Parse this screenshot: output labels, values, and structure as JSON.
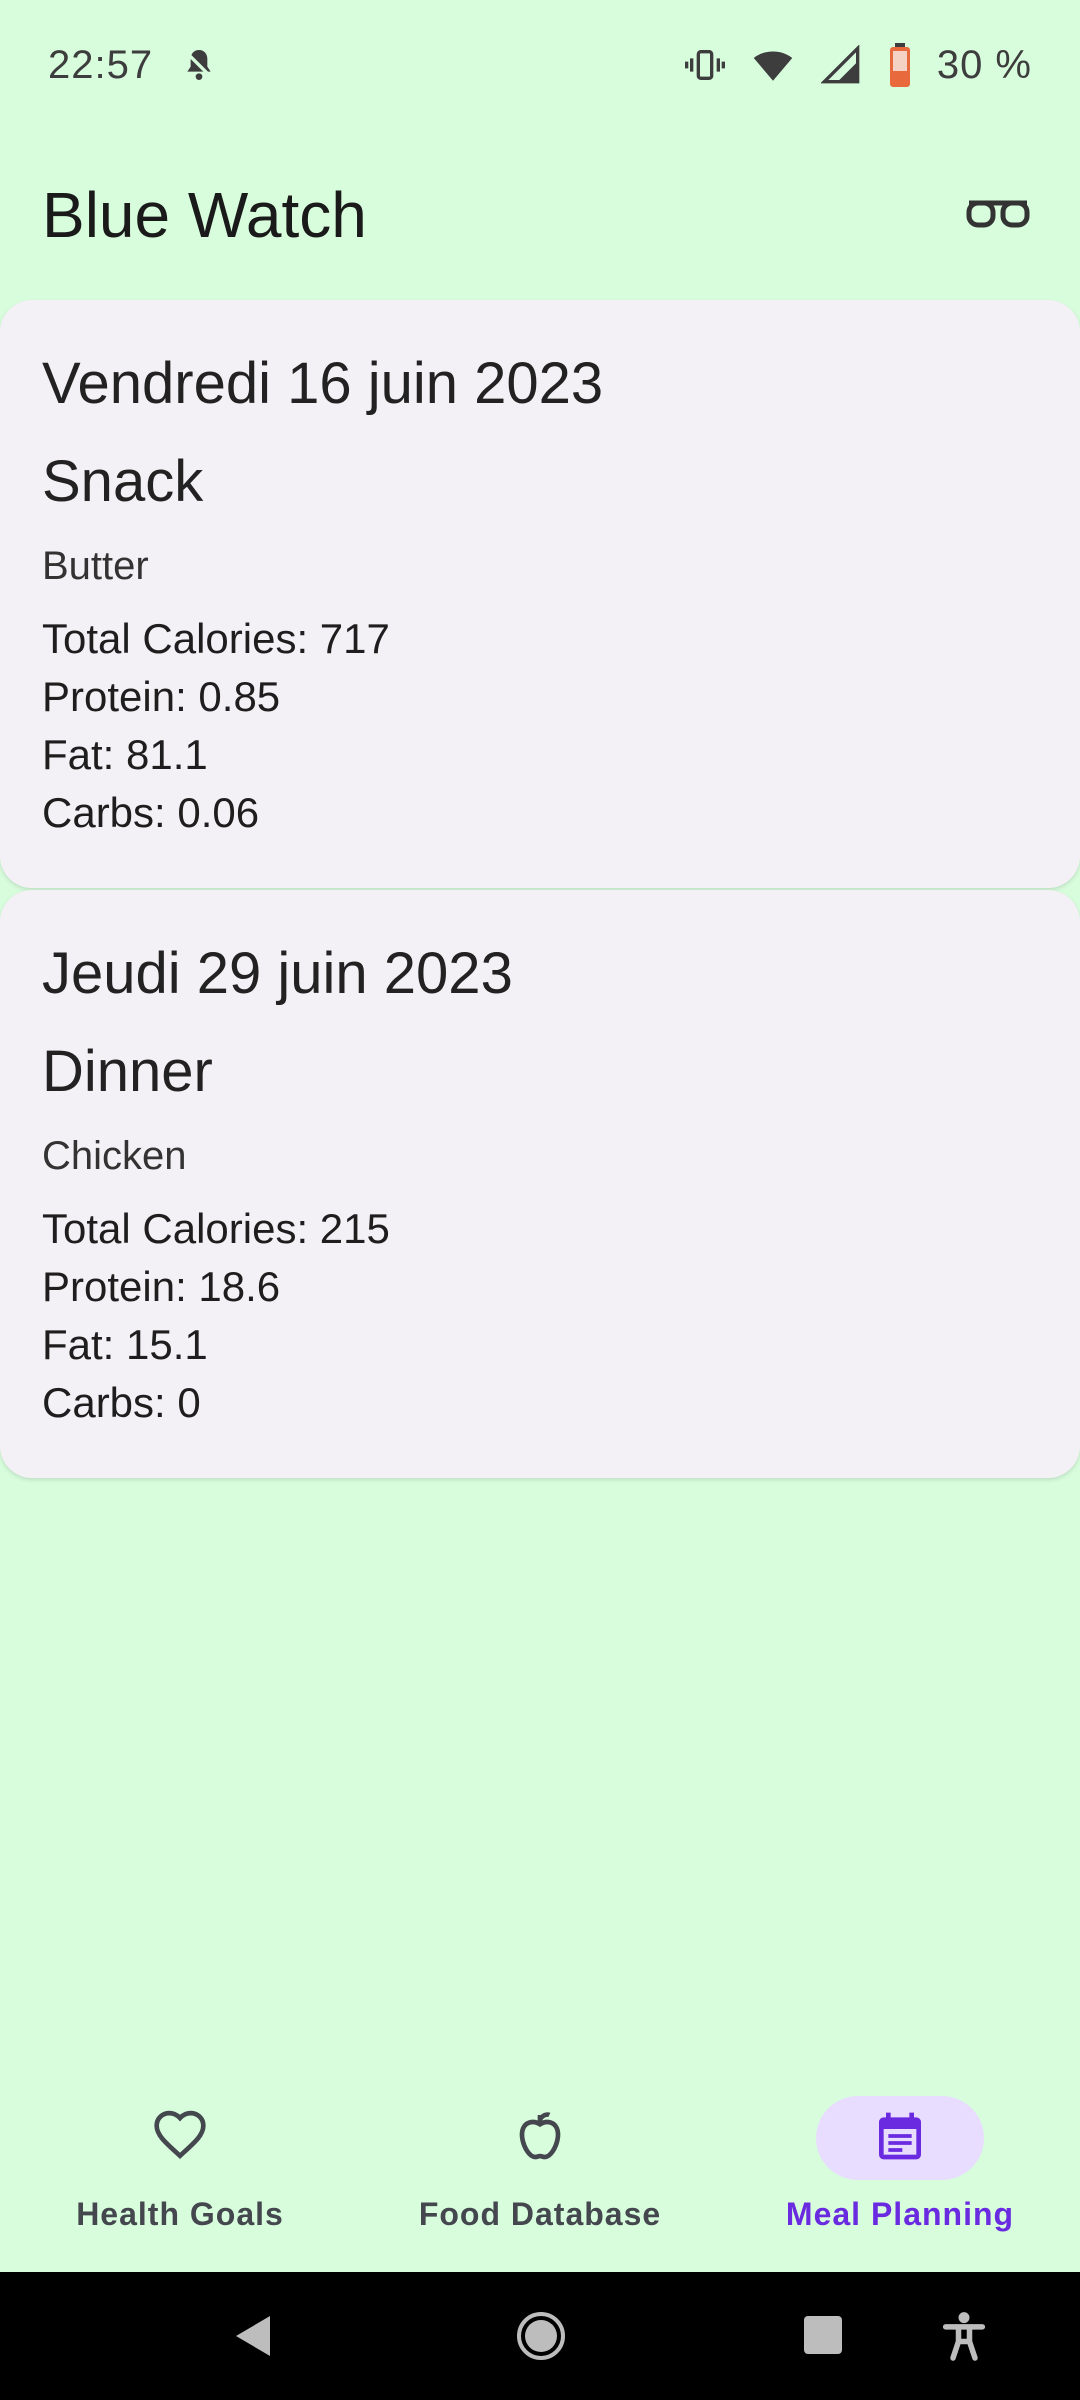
{
  "status_bar": {
    "time": "22:57",
    "battery": "30 %",
    "icons": [
      "notification-bell-icon",
      "vibrate-icon",
      "wifi-icon",
      "signal-icon",
      "battery-icon"
    ]
  },
  "app_bar": {
    "title": "Blue Watch",
    "action_icon": "glasses-icon"
  },
  "meals": [
    {
      "date": "Vendredi 16 juin 2023",
      "type": "Snack",
      "food": "Butter",
      "calories": "Total Calories: 717",
      "protein": "Protein: 0.85",
      "fat": "Fat: 81.1",
      "carbs": "Carbs: 0.06"
    },
    {
      "date": "Jeudi 29 juin 2023",
      "type": "Dinner",
      "food": "Chicken",
      "calories": "Total Calories: 215",
      "protein": "Protein: 18.6",
      "fat": "Fat: 15.1",
      "carbs": "Carbs: 0"
    }
  ],
  "bottom_nav": {
    "items": [
      {
        "label": "Health Goals",
        "icon": "heart-icon",
        "active": false
      },
      {
        "label": "Food Database",
        "icon": "apple-icon",
        "active": false
      },
      {
        "label": "Meal Planning",
        "icon": "calendar-icon",
        "active": true
      }
    ]
  },
  "colors": {
    "background": "#d8fddd",
    "card": "#f4f1f6",
    "accent": "#6a2be0",
    "accent_container": "#e9ddff"
  }
}
